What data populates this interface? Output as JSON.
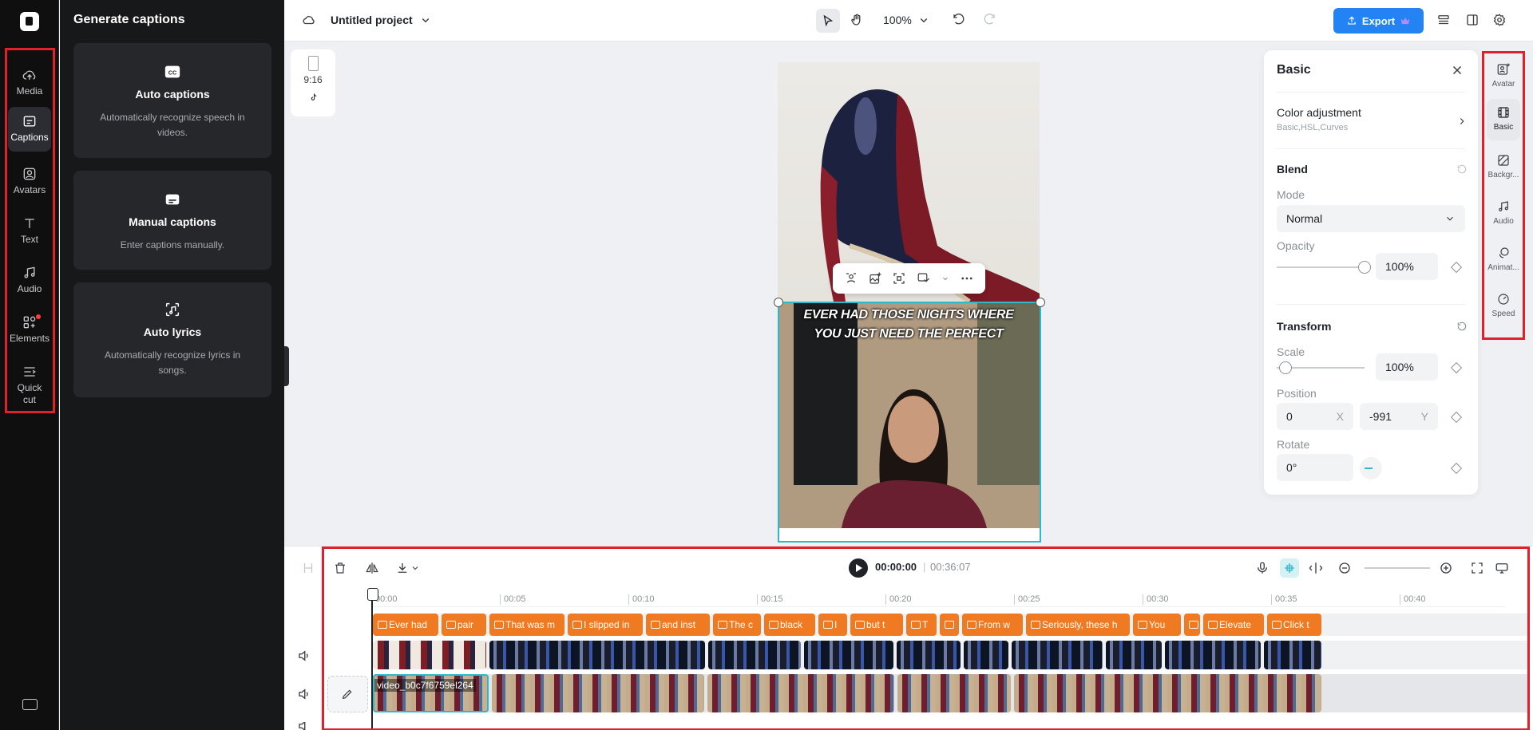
{
  "left_rail": {
    "items": [
      {
        "label": "Media",
        "icon": "cloud-upload-icon"
      },
      {
        "label": "Captions",
        "icon": "captions-icon",
        "active": true
      },
      {
        "label": "Avatars",
        "icon": "avatar-icon"
      },
      {
        "label": "Text",
        "icon": "text-icon"
      },
      {
        "label": "Audio",
        "icon": "music-note-icon"
      },
      {
        "label": "Elements",
        "icon": "elements-icon",
        "badge": true
      },
      {
        "label": "Quick",
        "label2": "cut",
        "icon": "quick-cut-icon"
      }
    ]
  },
  "captions_panel": {
    "title": "Generate captions",
    "cards": [
      {
        "title": "Auto captions",
        "desc": "Automatically recognize speech in videos.",
        "icon": "cc-icon"
      },
      {
        "title": "Manual captions",
        "desc": "Enter captions manually.",
        "icon": "subtitle-icon"
      },
      {
        "title": "Auto lyrics",
        "desc": "Automatically recognize lyrics in songs.",
        "icon": "lyrics-icon"
      }
    ]
  },
  "topbar": {
    "project_name": "Untitled project",
    "zoom": "100%",
    "export_label": "Export"
  },
  "canvas": {
    "ratio_label": "9:16",
    "caption_line1": "EVER HAD THOSE NIGHTS WHERE",
    "caption_line2": "YOU JUST NEED THE PERFECT"
  },
  "properties": {
    "title": "Basic",
    "color_adjustment": {
      "label": "Color adjustment",
      "sub": "Basic,HSL,Curves"
    },
    "blend": {
      "label": "Blend",
      "mode_label": "Mode",
      "mode_value": "Normal",
      "opacity_label": "Opacity",
      "opacity_value": "100%",
      "opacity_fraction": 1.0
    },
    "transform": {
      "label": "Transform",
      "scale_label": "Scale",
      "scale_value": "100%",
      "scale_fraction": 0.1,
      "position_label": "Position",
      "pos_x": "0",
      "pos_x_axis": "X",
      "pos_y": "-991",
      "pos_y_axis": "Y",
      "rotate_label": "Rotate",
      "rotate_value": "0°"
    }
  },
  "right_tools": [
    {
      "label": "Avatar",
      "icon": "avatar-add-icon"
    },
    {
      "label": "Basic",
      "icon": "film-icon",
      "active": true
    },
    {
      "label": "Backgr...",
      "icon": "background-icon"
    },
    {
      "label": "Audio",
      "icon": "music-note-icon"
    },
    {
      "label": "Animat...",
      "icon": "animation-icon"
    },
    {
      "label": "Speed",
      "icon": "speed-icon"
    }
  ],
  "timeline": {
    "current_time": "00:00:00",
    "separator": "|",
    "total_time": "00:36:07",
    "ruler_ticks": [
      "00:00",
      "00:05",
      "00:10",
      "00:15",
      "00:20",
      "00:25",
      "00:30",
      "00:35",
      "00:40"
    ],
    "caption_clips": [
      "Ever had",
      "pair",
      "That was m",
      "I slipped in",
      "and inst",
      "The c",
      "black",
      "I",
      "but t",
      "T",
      "",
      "From w",
      "Seriously, these h",
      "You",
      "",
      "Elevate",
      "Click t"
    ],
    "video_clip_label": "video_b0c7f6759el264"
  }
}
